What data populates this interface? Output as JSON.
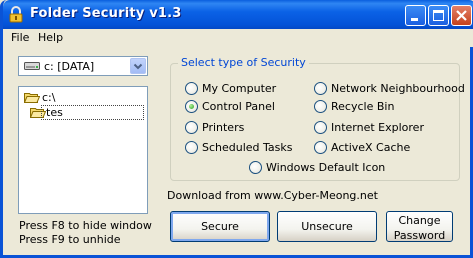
{
  "window": {
    "title": "Folder Security v1.3",
    "icon": "lock-icon",
    "controls": [
      "minimize",
      "maximize",
      "close"
    ]
  },
  "menu": {
    "file": "File",
    "help": "Help"
  },
  "drive_select": {
    "value": "c: [DATA]",
    "icon": "drive-icon"
  },
  "directory_list": {
    "items": [
      {
        "label": "c:\\",
        "icon": "open-folder-icon"
      },
      {
        "label": "tes",
        "icon": "open-folder-icon",
        "selected": true
      }
    ]
  },
  "hints": {
    "f8": "Press F8 to hide window",
    "f9": "Press F9 to unhide"
  },
  "security_group": {
    "legend": "Select type of Security",
    "options": [
      {
        "label": "My Computer",
        "checked": false
      },
      {
        "label": "Network Neighbourhood",
        "checked": false
      },
      {
        "label": "Control Panel",
        "checked": true
      },
      {
        "label": "Recycle Bin",
        "checked": false
      },
      {
        "label": "Printers",
        "checked": false
      },
      {
        "label": "Internet Explorer",
        "checked": false
      },
      {
        "label": "Scheduled Tasks",
        "checked": false
      },
      {
        "label": "ActiveX Cache",
        "checked": false
      },
      {
        "label": "Windows Default Icon",
        "checked": false
      }
    ]
  },
  "download_text": "Download from www.Cyber-Meong.net",
  "buttons": {
    "secure": "Secure",
    "unsecure": "Unsecure",
    "change_line1": "Change",
    "change_line2": "Password"
  },
  "colors": {
    "title_bar": "#0453d8",
    "group_legend": "#0046d5",
    "window_bg": "#ece9d8"
  }
}
